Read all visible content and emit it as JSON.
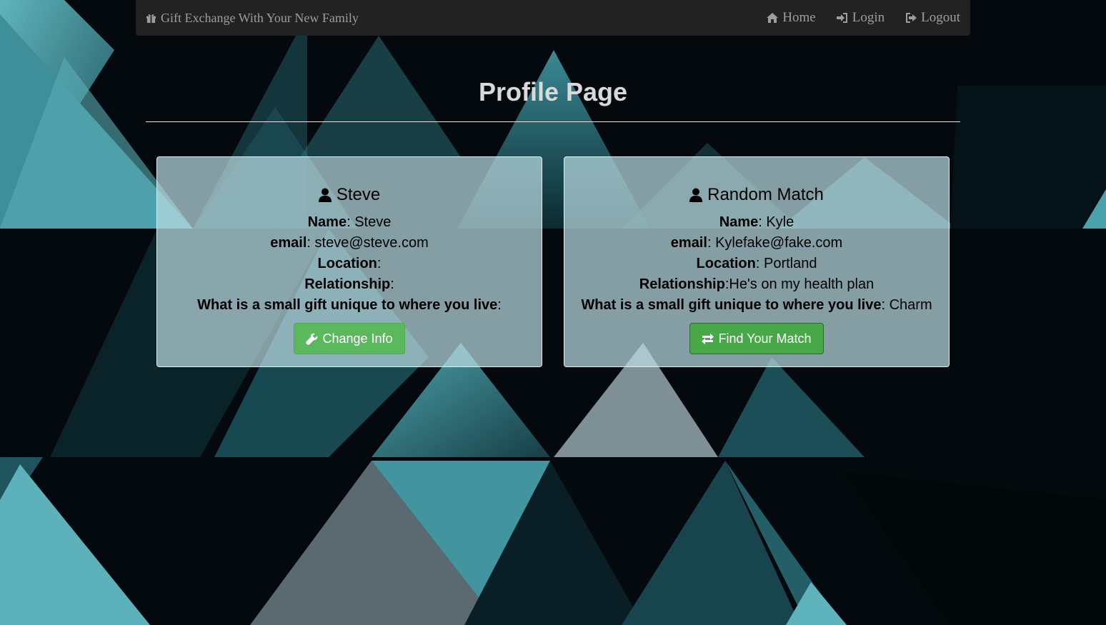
{
  "colors": {
    "navbar_bg": "#222222",
    "nav_text": "#9d9d9d",
    "button_green": "#5cb85c",
    "card_bg": "rgba(190,222,228,0.70)",
    "background_teal": "#4fa2ab"
  },
  "navbar": {
    "brand": {
      "icon": "gift-icon",
      "label": "Gift Exchange With Your New Family"
    },
    "links": [
      {
        "icon": "home-icon",
        "label": "Home"
      },
      {
        "icon": "sign-in-icon",
        "label": "Login"
      },
      {
        "icon": "sign-out-icon",
        "label": "Logout"
      }
    ]
  },
  "page": {
    "title": "Profile Page"
  },
  "profile_card": {
    "icon": "user-icon",
    "title": "Steve",
    "fields": [
      {
        "label": "Name",
        "sep": ": ",
        "value": "Steve"
      },
      {
        "label": "email",
        "sep": ": ",
        "value": "steve@steve.com"
      },
      {
        "label": "Location",
        "sep": ":",
        "value": ""
      },
      {
        "label": "Relationship",
        "sep": ":",
        "value": ""
      },
      {
        "label": "What is a small gift unique to where you live",
        "sep": ":",
        "value": ""
      }
    ],
    "button": {
      "icon": "wrench-icon",
      "label": "Change Info"
    }
  },
  "match_card": {
    "icon": "user-icon",
    "title": "Random Match",
    "fields": [
      {
        "label": "Name",
        "sep": ": ",
        "value": "Kyle"
      },
      {
        "label": "email",
        "sep": ": ",
        "value": "Kylefake@fake.com"
      },
      {
        "label": "Location",
        "sep": ": ",
        "value": "Portland"
      },
      {
        "label": "Relationship",
        "sep": ":",
        "value": "He's on my health plan"
      },
      {
        "label": "What is a small gift unique to where you live",
        "sep": ": ",
        "value": "Charm"
      }
    ],
    "button": {
      "icon": "exchange-icon",
      "label": "Find Your Match"
    }
  }
}
